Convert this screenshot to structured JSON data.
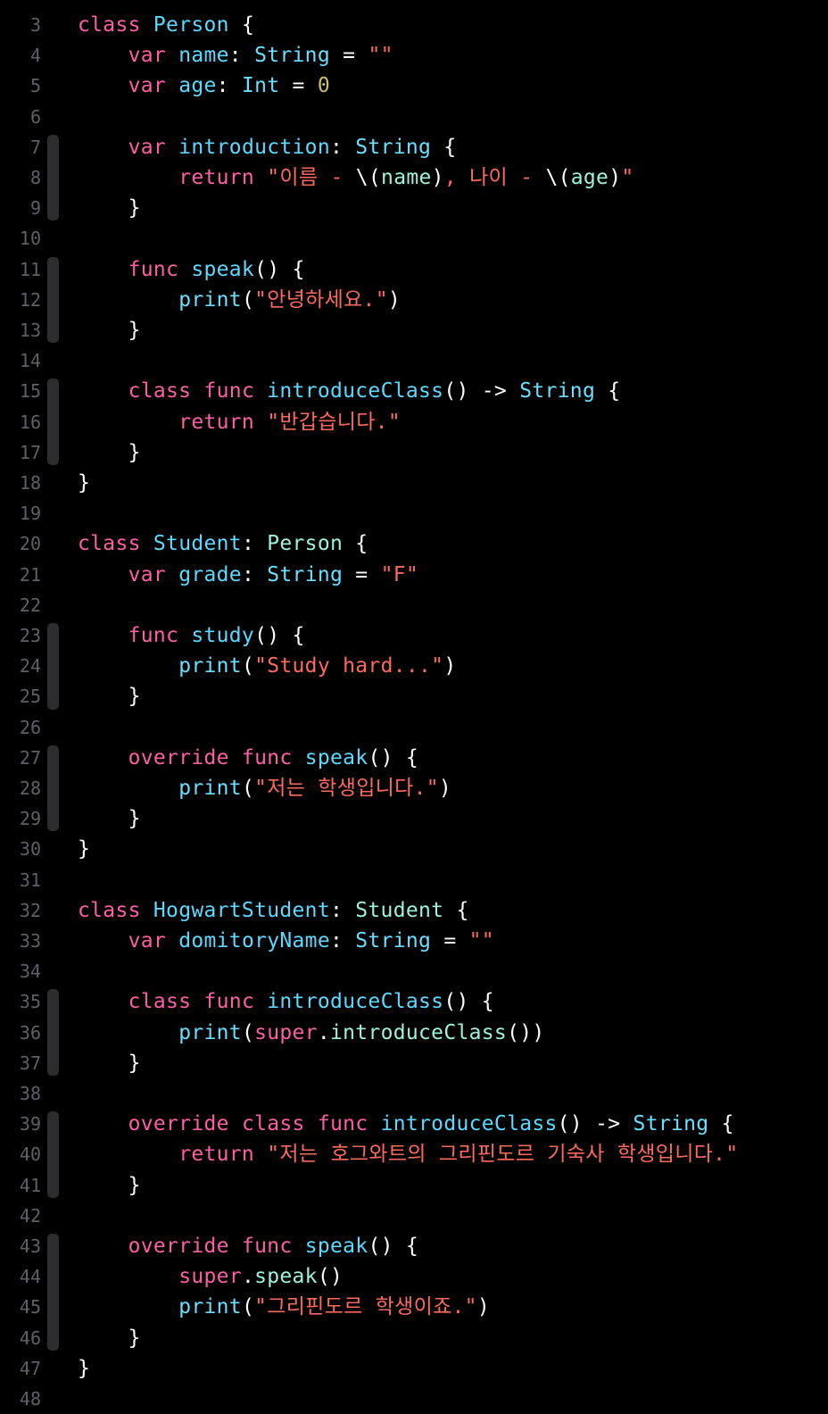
{
  "colors": {
    "background": "#000000",
    "line_number": "#5e6066",
    "keyword": "#ff7ab2",
    "declaration": "#6bdfff",
    "type": "#5dd8ff",
    "other_type": "#9ef1dd",
    "property": "#67b7a4",
    "string": "#ff8170",
    "number": "#d9c97c",
    "plain": "#ffffff"
  },
  "editor": {
    "lines": [
      {
        "n": "3",
        "tokens": [
          {
            "t": "class",
            "c": "kw"
          },
          {
            "t": " "
          },
          {
            "t": "Person",
            "c": "decl"
          },
          {
            "t": " {"
          }
        ]
      },
      {
        "n": "4",
        "tokens": [
          {
            "t": "    "
          },
          {
            "t": "var",
            "c": "kw"
          },
          {
            "t": " "
          },
          {
            "t": "name",
            "c": "decl"
          },
          {
            "t": ": "
          },
          {
            "t": "String",
            "c": "ptype"
          },
          {
            "t": " = "
          },
          {
            "t": "\"\"",
            "c": "str"
          }
        ]
      },
      {
        "n": "5",
        "tokens": [
          {
            "t": "    "
          },
          {
            "t": "var",
            "c": "kw"
          },
          {
            "t": " "
          },
          {
            "t": "age",
            "c": "decl"
          },
          {
            "t": ": "
          },
          {
            "t": "Int",
            "c": "ptype"
          },
          {
            "t": " = "
          },
          {
            "t": "0",
            "c": "num"
          }
        ]
      },
      {
        "n": "6",
        "tokens": []
      },
      {
        "n": "7",
        "tokens": [
          {
            "t": "    "
          },
          {
            "t": "var",
            "c": "kw"
          },
          {
            "t": " "
          },
          {
            "t": "introduction",
            "c": "decl"
          },
          {
            "t": ": "
          },
          {
            "t": "String",
            "c": "ptype"
          },
          {
            "t": " {"
          }
        ]
      },
      {
        "n": "8",
        "tokens": [
          {
            "t": "        "
          },
          {
            "t": "return",
            "c": "kw"
          },
          {
            "t": " "
          },
          {
            "t": "\"이름 - ",
            "c": "str"
          },
          {
            "t": "\\(",
            "c": "plain"
          },
          {
            "t": "name",
            "c": "uty"
          },
          {
            "t": ")",
            "c": "plain"
          },
          {
            "t": ", 나이 - ",
            "c": "str"
          },
          {
            "t": "\\(",
            "c": "plain"
          },
          {
            "t": "age",
            "c": "uty"
          },
          {
            "t": ")",
            "c": "plain"
          },
          {
            "t": "\"",
            "c": "str"
          }
        ]
      },
      {
        "n": "9",
        "tokens": [
          {
            "t": "    }"
          }
        ]
      },
      {
        "n": "10",
        "tokens": []
      },
      {
        "n": "11",
        "tokens": [
          {
            "t": "    "
          },
          {
            "t": "func",
            "c": "kw"
          },
          {
            "t": " "
          },
          {
            "t": "speak",
            "c": "decl"
          },
          {
            "t": "() {"
          }
        ]
      },
      {
        "n": "12",
        "tokens": [
          {
            "t": "        "
          },
          {
            "t": "print",
            "c": "ptype"
          },
          {
            "t": "("
          },
          {
            "t": "\"안녕하세요.\"",
            "c": "str"
          },
          {
            "t": ")"
          }
        ]
      },
      {
        "n": "13",
        "tokens": [
          {
            "t": "    }"
          }
        ]
      },
      {
        "n": "14",
        "tokens": []
      },
      {
        "n": "15",
        "tokens": [
          {
            "t": "    "
          },
          {
            "t": "class",
            "c": "kw"
          },
          {
            "t": " "
          },
          {
            "t": "func",
            "c": "kw"
          },
          {
            "t": " "
          },
          {
            "t": "introduceClass",
            "c": "decl"
          },
          {
            "t": "() -> "
          },
          {
            "t": "String",
            "c": "ptype"
          },
          {
            "t": " {"
          }
        ]
      },
      {
        "n": "16",
        "tokens": [
          {
            "t": "        "
          },
          {
            "t": "return",
            "c": "kw"
          },
          {
            "t": " "
          },
          {
            "t": "\"반갑습니다.\"",
            "c": "str"
          }
        ]
      },
      {
        "n": "17",
        "tokens": [
          {
            "t": "    }"
          }
        ]
      },
      {
        "n": "18",
        "tokens": [
          {
            "t": "}"
          }
        ]
      },
      {
        "n": "19",
        "tokens": []
      },
      {
        "n": "20",
        "tokens": [
          {
            "t": "class",
            "c": "kw"
          },
          {
            "t": " "
          },
          {
            "t": "Student",
            "c": "decl"
          },
          {
            "t": ": "
          },
          {
            "t": "Person",
            "c": "uty"
          },
          {
            "t": " {"
          }
        ]
      },
      {
        "n": "21",
        "tokens": [
          {
            "t": "    "
          },
          {
            "t": "var",
            "c": "kw"
          },
          {
            "t": " "
          },
          {
            "t": "grade",
            "c": "decl"
          },
          {
            "t": ": "
          },
          {
            "t": "String",
            "c": "ptype"
          },
          {
            "t": " = "
          },
          {
            "t": "\"F\"",
            "c": "str"
          }
        ]
      },
      {
        "n": "22",
        "tokens": []
      },
      {
        "n": "23",
        "tokens": [
          {
            "t": "    "
          },
          {
            "t": "func",
            "c": "kw"
          },
          {
            "t": " "
          },
          {
            "t": "study",
            "c": "decl"
          },
          {
            "t": "() {"
          }
        ]
      },
      {
        "n": "24",
        "tokens": [
          {
            "t": "        "
          },
          {
            "t": "print",
            "c": "ptype"
          },
          {
            "t": "("
          },
          {
            "t": "\"Study hard...\"",
            "c": "str"
          },
          {
            "t": ")"
          }
        ]
      },
      {
        "n": "25",
        "tokens": [
          {
            "t": "    }"
          }
        ]
      },
      {
        "n": "26",
        "tokens": []
      },
      {
        "n": "27",
        "tokens": [
          {
            "t": "    "
          },
          {
            "t": "override",
            "c": "kw"
          },
          {
            "t": " "
          },
          {
            "t": "func",
            "c": "kw"
          },
          {
            "t": " "
          },
          {
            "t": "speak",
            "c": "decl"
          },
          {
            "t": "() {"
          }
        ]
      },
      {
        "n": "28",
        "tokens": [
          {
            "t": "        "
          },
          {
            "t": "print",
            "c": "ptype"
          },
          {
            "t": "("
          },
          {
            "t": "\"저는 학생입니다.\"",
            "c": "str"
          },
          {
            "t": ")"
          }
        ]
      },
      {
        "n": "29",
        "tokens": [
          {
            "t": "    }"
          }
        ]
      },
      {
        "n": "30",
        "tokens": [
          {
            "t": "}"
          }
        ]
      },
      {
        "n": "31",
        "tokens": []
      },
      {
        "n": "32",
        "tokens": [
          {
            "t": "class",
            "c": "kw"
          },
          {
            "t": " "
          },
          {
            "t": "HogwartStudent",
            "c": "decl"
          },
          {
            "t": ": "
          },
          {
            "t": "Student",
            "c": "uty"
          },
          {
            "t": " {"
          }
        ]
      },
      {
        "n": "33",
        "tokens": [
          {
            "t": "    "
          },
          {
            "t": "var",
            "c": "kw"
          },
          {
            "t": " "
          },
          {
            "t": "domitoryName",
            "c": "decl"
          },
          {
            "t": ": "
          },
          {
            "t": "String",
            "c": "ptype"
          },
          {
            "t": " = "
          },
          {
            "t": "\"\"",
            "c": "str"
          }
        ]
      },
      {
        "n": "34",
        "tokens": []
      },
      {
        "n": "35",
        "tokens": [
          {
            "t": "    "
          },
          {
            "t": "class",
            "c": "kw"
          },
          {
            "t": " "
          },
          {
            "t": "func",
            "c": "kw"
          },
          {
            "t": " "
          },
          {
            "t": "introduceClass",
            "c": "decl"
          },
          {
            "t": "() {"
          }
        ]
      },
      {
        "n": "36",
        "tokens": [
          {
            "t": "        "
          },
          {
            "t": "print",
            "c": "ptype"
          },
          {
            "t": "("
          },
          {
            "t": "super",
            "c": "kw"
          },
          {
            "t": "."
          },
          {
            "t": "introduceClass",
            "c": "uty"
          },
          {
            "t": "())"
          }
        ]
      },
      {
        "n": "37",
        "tokens": [
          {
            "t": "    }"
          }
        ]
      },
      {
        "n": "38",
        "tokens": []
      },
      {
        "n": "39",
        "tokens": [
          {
            "t": "    "
          },
          {
            "t": "override",
            "c": "kw"
          },
          {
            "t": " "
          },
          {
            "t": "class",
            "c": "kw"
          },
          {
            "t": " "
          },
          {
            "t": "func",
            "c": "kw"
          },
          {
            "t": " "
          },
          {
            "t": "introduceClass",
            "c": "decl"
          },
          {
            "t": "() -> "
          },
          {
            "t": "String",
            "c": "ptype"
          },
          {
            "t": " {"
          }
        ]
      },
      {
        "n": "40",
        "tokens": [
          {
            "t": "        "
          },
          {
            "t": "return",
            "c": "kw"
          },
          {
            "t": " "
          },
          {
            "t": "\"저는 호그와트의 그리핀도르 기숙사 학생입니다.\"",
            "c": "str"
          }
        ]
      },
      {
        "n": "41",
        "tokens": [
          {
            "t": "    }"
          }
        ]
      },
      {
        "n": "42",
        "tokens": []
      },
      {
        "n": "43",
        "tokens": [
          {
            "t": "    "
          },
          {
            "t": "override",
            "c": "kw"
          },
          {
            "t": " "
          },
          {
            "t": "func",
            "c": "kw"
          },
          {
            "t": " "
          },
          {
            "t": "speak",
            "c": "decl"
          },
          {
            "t": "() {"
          }
        ]
      },
      {
        "n": "44",
        "tokens": [
          {
            "t": "        "
          },
          {
            "t": "super",
            "c": "kw"
          },
          {
            "t": "."
          },
          {
            "t": "speak",
            "c": "uty"
          },
          {
            "t": "()"
          }
        ]
      },
      {
        "n": "45",
        "tokens": [
          {
            "t": "        "
          },
          {
            "t": "print",
            "c": "ptype"
          },
          {
            "t": "("
          },
          {
            "t": "\"그리핀도르 학생이죠.\"",
            "c": "str"
          },
          {
            "t": ")"
          }
        ]
      },
      {
        "n": "46",
        "tokens": [
          {
            "t": "    }"
          }
        ]
      },
      {
        "n": "47",
        "tokens": [
          {
            "t": "}"
          }
        ]
      },
      {
        "n": "48",
        "tokens": []
      }
    ]
  }
}
